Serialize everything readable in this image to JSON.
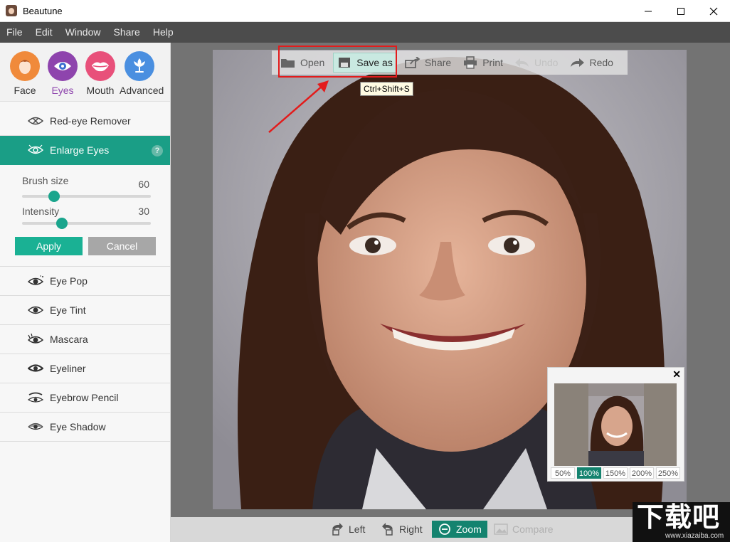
{
  "window": {
    "title": "Beautune",
    "minimize": "—",
    "maximize": "☐",
    "close": "✕"
  },
  "menu": [
    "File",
    "Edit",
    "Window",
    "Share",
    "Help"
  ],
  "categories": [
    {
      "label": "Face",
      "color": "#f08a3b"
    },
    {
      "label": "Eyes",
      "color": "#8e44ad"
    },
    {
      "label": "Mouth",
      "color": "#e8507a"
    },
    {
      "label": "Advanced",
      "color": "#4a8fe0"
    }
  ],
  "tools": {
    "red_eye": "Red-eye Remover",
    "enlarge_eyes": "Enlarge Eyes",
    "help": "?",
    "eye_pop": "Eye Pop",
    "eye_tint": "Eye Tint",
    "mascara": "Mascara",
    "eyeliner": "Eyeliner",
    "eyebrow_pencil": "Eyebrow Pencil",
    "eye_shadow": "Eye Shadow"
  },
  "panel": {
    "brush_size_label": "Brush size",
    "brush_size_value": "60",
    "brush_size_fraction": 0.25,
    "intensity_label": "Intensity",
    "intensity_value": "30",
    "intensity_fraction": 0.31,
    "apply": "Apply",
    "cancel": "Cancel"
  },
  "toolbar": {
    "open": "Open",
    "save_as": "Save as",
    "share": "Share",
    "print": "Print",
    "undo": "Undo",
    "redo": "Redo",
    "tooltip": "Ctrl+Shift+S"
  },
  "navigator": {
    "close": "✕",
    "zoom_options": [
      "50%",
      "100%",
      "150%",
      "200%",
      "250%"
    ],
    "selected_zoom": "100%"
  },
  "bottom": {
    "left": "Left",
    "right": "Right",
    "zoom": "Zoom",
    "compare": "Compare"
  },
  "watermark": {
    "logo": "下载吧",
    "url": "www.xiazaiba.com"
  },
  "colors": {
    "accent": "#1a9e86",
    "highlight_box": "#e31b1b"
  }
}
